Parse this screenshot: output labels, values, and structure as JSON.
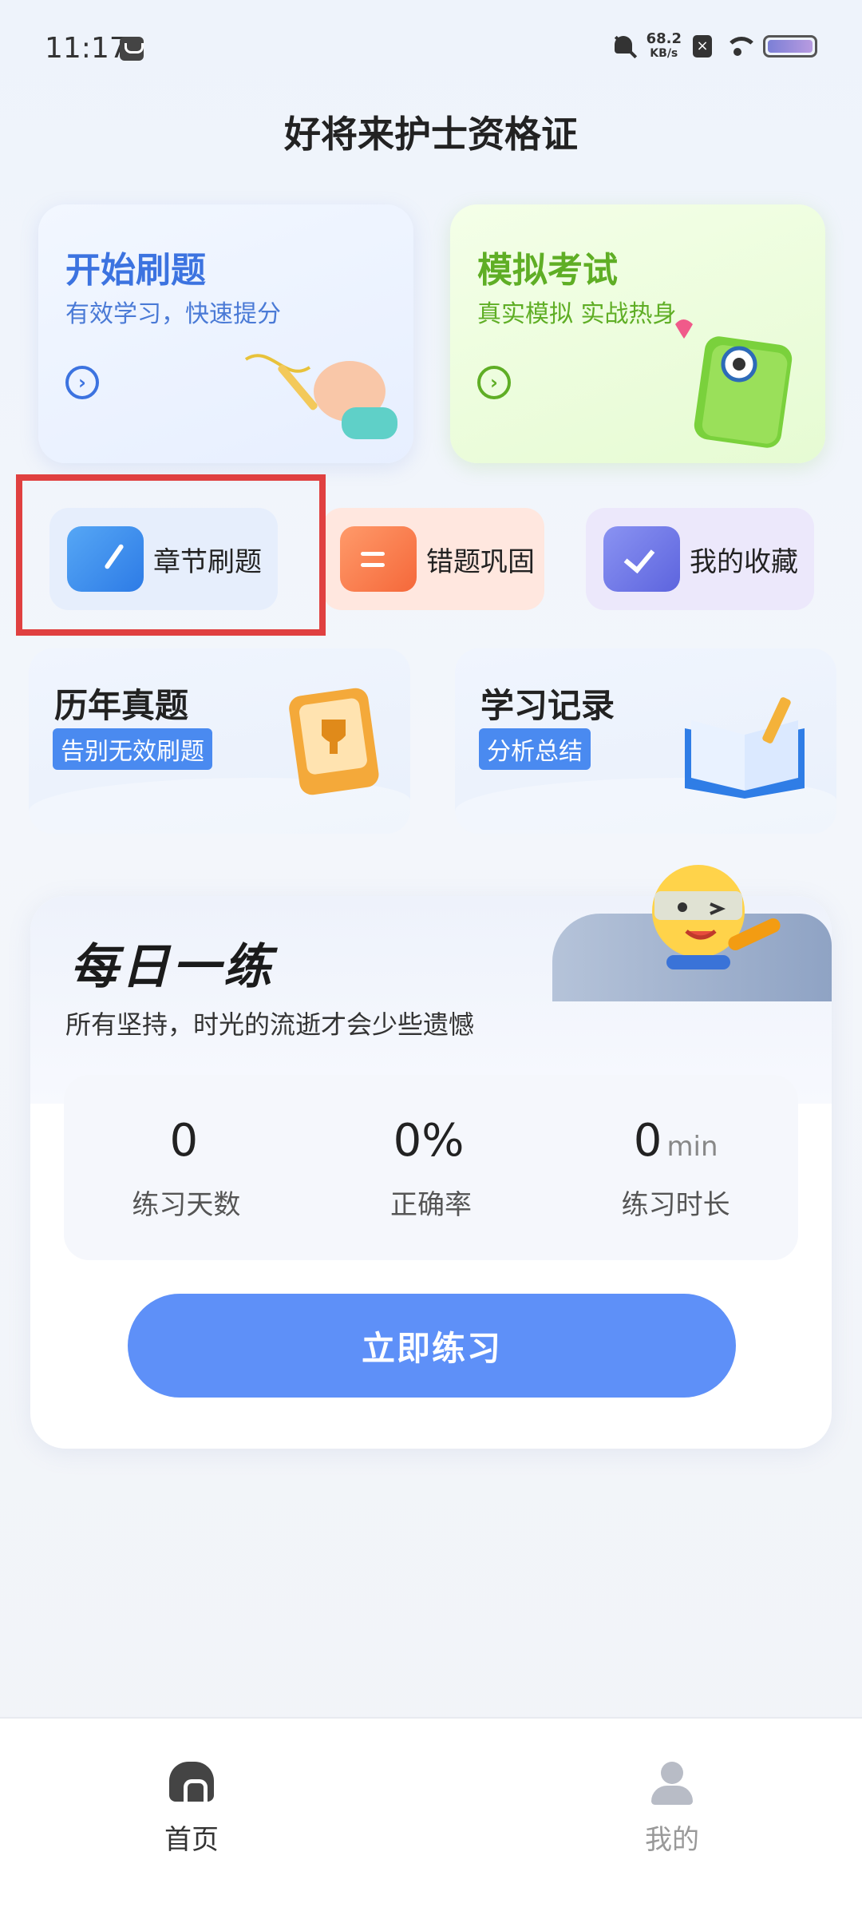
{
  "status": {
    "time": "11:17",
    "net_speed": "68.2",
    "net_unit": "KB/s"
  },
  "app_title": "好将来护士资格证",
  "cards": {
    "start": {
      "title": "开始刷题",
      "subtitle": "有效学习，快速提分",
      "icon": "arrow-right-icon"
    },
    "exam": {
      "title": "模拟考试",
      "subtitle": "真实模拟 实战热身",
      "icon": "arrow-right-icon"
    }
  },
  "tiles": {
    "chapter": {
      "label": "章节刷题",
      "icon": "book-icon"
    },
    "wrong": {
      "label": "错题巩固",
      "icon": "calendar-icon"
    },
    "favorite": {
      "label": "我的收藏",
      "icon": "check-icon"
    }
  },
  "mid_cards": {
    "history": {
      "title": "历年真题",
      "badge": "告别无效刷题"
    },
    "record": {
      "title": "学习记录",
      "badge": "分析总结"
    }
  },
  "daily": {
    "title": "每日一练",
    "subtitle": "所有坚持，时光的流逝才会少些遗憾",
    "stats": [
      {
        "value": "0",
        "unit": "",
        "label": "练习天数"
      },
      {
        "value": "0%",
        "unit": "",
        "label": "正确率"
      },
      {
        "value": "0",
        "unit": "min",
        "label": "练习时长"
      }
    ],
    "button": "立即练习"
  },
  "nav": {
    "home": "首页",
    "mine": "我的"
  },
  "colors": {
    "accent": "#5e90f8",
    "highlight": "#e04040",
    "green": "#5fae25",
    "blue": "#3c73e0"
  }
}
